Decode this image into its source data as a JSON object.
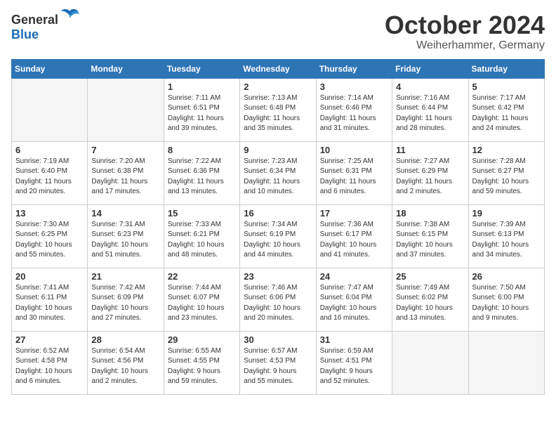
{
  "logo": {
    "general": "General",
    "blue": "Blue"
  },
  "title": "October 2024",
  "location": "Weiherhammer, Germany",
  "days_of_week": [
    "Sunday",
    "Monday",
    "Tuesday",
    "Wednesday",
    "Thursday",
    "Friday",
    "Saturday"
  ],
  "weeks": [
    [
      {
        "day": "",
        "info": ""
      },
      {
        "day": "",
        "info": ""
      },
      {
        "day": "1",
        "info": "Sunrise: 7:11 AM\nSunset: 6:51 PM\nDaylight: 11 hours\nand 39 minutes."
      },
      {
        "day": "2",
        "info": "Sunrise: 7:13 AM\nSunset: 6:48 PM\nDaylight: 11 hours\nand 35 minutes."
      },
      {
        "day": "3",
        "info": "Sunrise: 7:14 AM\nSunset: 6:46 PM\nDaylight: 11 hours\nand 31 minutes."
      },
      {
        "day": "4",
        "info": "Sunrise: 7:16 AM\nSunset: 6:44 PM\nDaylight: 11 hours\nand 28 minutes."
      },
      {
        "day": "5",
        "info": "Sunrise: 7:17 AM\nSunset: 6:42 PM\nDaylight: 11 hours\nand 24 minutes."
      }
    ],
    [
      {
        "day": "6",
        "info": "Sunrise: 7:19 AM\nSunset: 6:40 PM\nDaylight: 11 hours\nand 20 minutes."
      },
      {
        "day": "7",
        "info": "Sunrise: 7:20 AM\nSunset: 6:38 PM\nDaylight: 11 hours\nand 17 minutes."
      },
      {
        "day": "8",
        "info": "Sunrise: 7:22 AM\nSunset: 6:36 PM\nDaylight: 11 hours\nand 13 minutes."
      },
      {
        "day": "9",
        "info": "Sunrise: 7:23 AM\nSunset: 6:34 PM\nDaylight: 11 hours\nand 10 minutes."
      },
      {
        "day": "10",
        "info": "Sunrise: 7:25 AM\nSunset: 6:31 PM\nDaylight: 11 hours\nand 6 minutes."
      },
      {
        "day": "11",
        "info": "Sunrise: 7:27 AM\nSunset: 6:29 PM\nDaylight: 11 hours\nand 2 minutes."
      },
      {
        "day": "12",
        "info": "Sunrise: 7:28 AM\nSunset: 6:27 PM\nDaylight: 10 hours\nand 59 minutes."
      }
    ],
    [
      {
        "day": "13",
        "info": "Sunrise: 7:30 AM\nSunset: 6:25 PM\nDaylight: 10 hours\nand 55 minutes."
      },
      {
        "day": "14",
        "info": "Sunrise: 7:31 AM\nSunset: 6:23 PM\nDaylight: 10 hours\nand 51 minutes."
      },
      {
        "day": "15",
        "info": "Sunrise: 7:33 AM\nSunset: 6:21 PM\nDaylight: 10 hours\nand 48 minutes."
      },
      {
        "day": "16",
        "info": "Sunrise: 7:34 AM\nSunset: 6:19 PM\nDaylight: 10 hours\nand 44 minutes."
      },
      {
        "day": "17",
        "info": "Sunrise: 7:36 AM\nSunset: 6:17 PM\nDaylight: 10 hours\nand 41 minutes."
      },
      {
        "day": "18",
        "info": "Sunrise: 7:38 AM\nSunset: 6:15 PM\nDaylight: 10 hours\nand 37 minutes."
      },
      {
        "day": "19",
        "info": "Sunrise: 7:39 AM\nSunset: 6:13 PM\nDaylight: 10 hours\nand 34 minutes."
      }
    ],
    [
      {
        "day": "20",
        "info": "Sunrise: 7:41 AM\nSunset: 6:11 PM\nDaylight: 10 hours\nand 30 minutes."
      },
      {
        "day": "21",
        "info": "Sunrise: 7:42 AM\nSunset: 6:09 PM\nDaylight: 10 hours\nand 27 minutes."
      },
      {
        "day": "22",
        "info": "Sunrise: 7:44 AM\nSunset: 6:07 PM\nDaylight: 10 hours\nand 23 minutes."
      },
      {
        "day": "23",
        "info": "Sunrise: 7:46 AM\nSunset: 6:06 PM\nDaylight: 10 hours\nand 20 minutes."
      },
      {
        "day": "24",
        "info": "Sunrise: 7:47 AM\nSunset: 6:04 PM\nDaylight: 10 hours\nand 16 minutes."
      },
      {
        "day": "25",
        "info": "Sunrise: 7:49 AM\nSunset: 6:02 PM\nDaylight: 10 hours\nand 13 minutes."
      },
      {
        "day": "26",
        "info": "Sunrise: 7:50 AM\nSunset: 6:00 PM\nDaylight: 10 hours\nand 9 minutes."
      }
    ],
    [
      {
        "day": "27",
        "info": "Sunrise: 6:52 AM\nSunset: 4:58 PM\nDaylight: 10 hours\nand 6 minutes."
      },
      {
        "day": "28",
        "info": "Sunrise: 6:54 AM\nSunset: 4:56 PM\nDaylight: 10 hours\nand 2 minutes."
      },
      {
        "day": "29",
        "info": "Sunrise: 6:55 AM\nSunset: 4:55 PM\nDaylight: 9 hours\nand 59 minutes."
      },
      {
        "day": "30",
        "info": "Sunrise: 6:57 AM\nSunset: 4:53 PM\nDaylight: 9 hours\nand 55 minutes."
      },
      {
        "day": "31",
        "info": "Sunrise: 6:59 AM\nSunset: 4:51 PM\nDaylight: 9 hours\nand 52 minutes."
      },
      {
        "day": "",
        "info": ""
      },
      {
        "day": "",
        "info": ""
      }
    ]
  ]
}
